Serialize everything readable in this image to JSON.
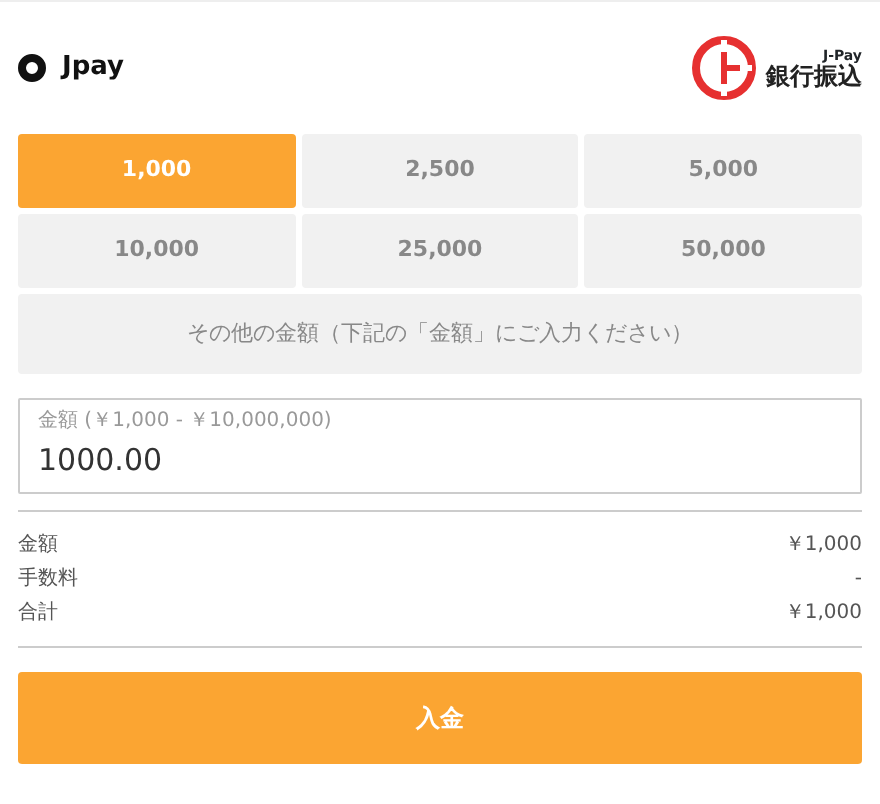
{
  "payment_method": {
    "label": "Jpay",
    "selected": true,
    "logo_tag": "J-Pay",
    "logo_text": "銀行振込"
  },
  "amount_options": [
    {
      "label": "1,000",
      "selected": true
    },
    {
      "label": "2,500",
      "selected": false
    },
    {
      "label": "5,000",
      "selected": false
    },
    {
      "label": "10,000",
      "selected": false
    },
    {
      "label": "25,000",
      "selected": false
    },
    {
      "label": "50,000",
      "selected": false
    }
  ],
  "other_amount": {
    "label": "その他の金額（下記の「金額」にご入力ください）",
    "selected": false
  },
  "amount_field": {
    "label": "金額 (￥1,000 - ￥10,000,000)",
    "value": "1000.00"
  },
  "summary": [
    {
      "label": "金額",
      "value": "￥1,000"
    },
    {
      "label": "手数料",
      "value": "-"
    },
    {
      "label": "合計",
      "value": "￥1,000"
    }
  ],
  "submit_button": "入金"
}
